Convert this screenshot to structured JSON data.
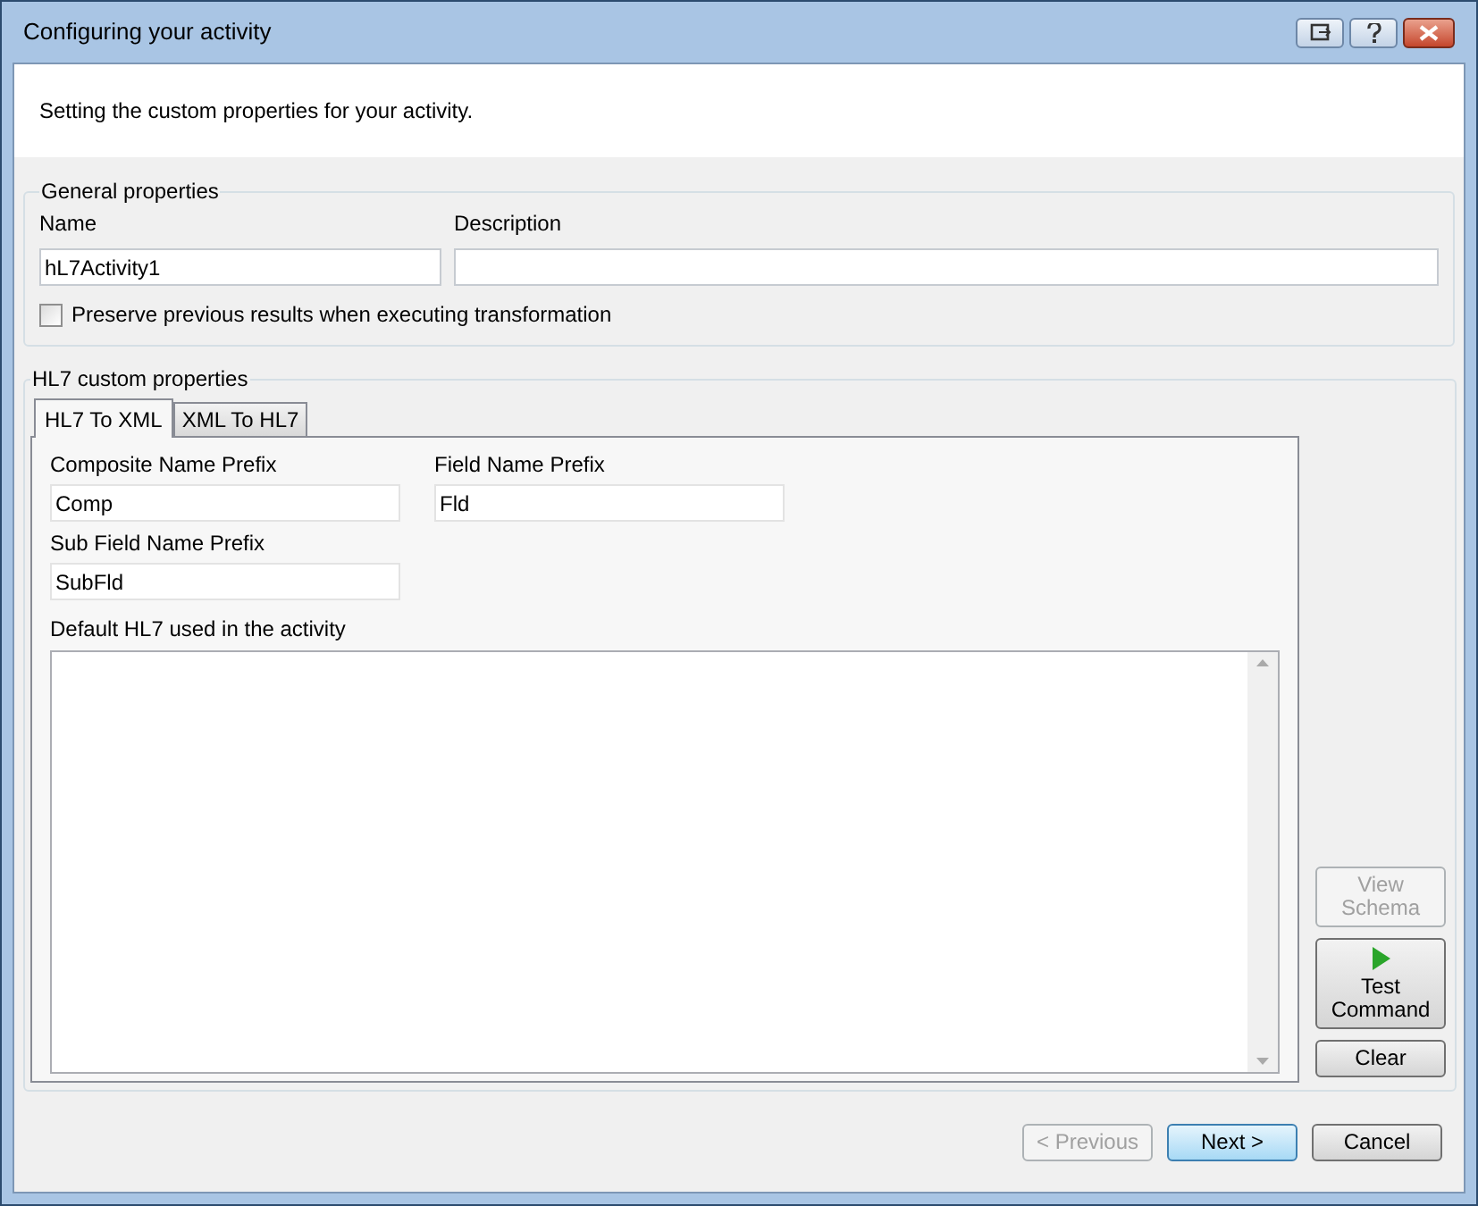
{
  "window": {
    "title": "Configuring your activity"
  },
  "header": {
    "text": "Setting the custom properties for your activity."
  },
  "general": {
    "legend": "General properties",
    "name": {
      "label": "Name",
      "value": "hL7Activity1"
    },
    "description": {
      "label": "Description"
    },
    "preserve": {
      "label": "Preserve previous results when executing transformation",
      "checked": false
    }
  },
  "hl7": {
    "legend": "HL7 custom properties",
    "tabs": [
      {
        "label": "HL7 To XML",
        "selected": true
      },
      {
        "label": "XML To HL7",
        "selected": false
      }
    ],
    "fields": [
      {
        "label": "Composite Name Prefix",
        "value": "Comp"
      },
      {
        "label": "Field Name Prefix",
        "value": "Fld"
      },
      {
        "label": "Sub Field Name Prefix",
        "value": "SubFld"
      }
    ],
    "default_label": "Default HL7 used in the activity",
    "side_buttons": [
      {
        "kind": "text",
        "label": "View Schema",
        "disabled": true
      },
      {
        "kind": "run",
        "label": "Test Command",
        "disabled": false
      },
      {
        "kind": "text",
        "label": "Clear",
        "disabled": false
      }
    ]
  },
  "footer": [
    {
      "label": "< Previous",
      "disabled": true,
      "default": false
    },
    {
      "label": "Next >",
      "disabled": false,
      "default": true
    },
    {
      "label": "Cancel",
      "disabled": false,
      "default": false
    }
  ]
}
